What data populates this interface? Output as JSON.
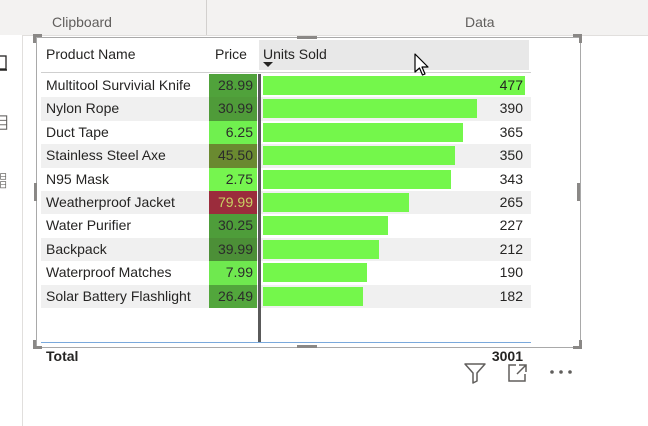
{
  "ribbon": {
    "clipboard_label": "Clipboard",
    "data_label": "Data"
  },
  "table": {
    "headers": {
      "name": "Product Name",
      "price": "Price",
      "units": "Units Sold"
    },
    "max_units": 477,
    "rows": [
      {
        "name": "Multitool Survivial Knife",
        "price": "28.99",
        "units": "477",
        "units_value": 477,
        "price_color": "#50a23b"
      },
      {
        "name": "Nylon Rope",
        "price": "30.99",
        "units": "390",
        "units_value": 390,
        "price_color": "#4f9b39"
      },
      {
        "name": "Duct Tape",
        "price": "6.25",
        "units": "365",
        "units_value": 365,
        "price_color": "#70f04f"
      },
      {
        "name": "Stainless Steel Axe",
        "price": "45.50",
        "units": "350",
        "units_value": 350,
        "price_color": "#6a8a30"
      },
      {
        "name": "N95 Mask",
        "price": "2.75",
        "units": "343",
        "units_value": 343,
        "price_color": "#76f54f"
      },
      {
        "name": "Weatherproof Jacket",
        "price": "79.99",
        "units": "265",
        "units_value": 265,
        "price_color": "#9b2c3c"
      },
      {
        "name": "Water Purifier",
        "price": "30.25",
        "units": "227",
        "units_value": 227,
        "price_color": "#4e9d3a"
      },
      {
        "name": "Backpack",
        "price": "39.99",
        "units": "212",
        "units_value": 212,
        "price_color": "#4c8f37"
      },
      {
        "name": "Waterproof Matches",
        "price": "7.99",
        "units": "190",
        "units_value": 190,
        "price_color": "#6fe94f"
      },
      {
        "name": "Solar Battery Flashlight",
        "price": "26.49",
        "units": "182",
        "units_value": 182,
        "price_color": "#52a63c"
      }
    ],
    "total_label": "Total",
    "total_value": "3001"
  },
  "colors": {
    "bar": "#74f74b",
    "price_text_light": "#252423",
    "price_text_dark": "#3a3a3a"
  },
  "icons": {
    "filter": "filter-icon",
    "focus": "focus-mode-icon",
    "more": "more-options-icon"
  }
}
